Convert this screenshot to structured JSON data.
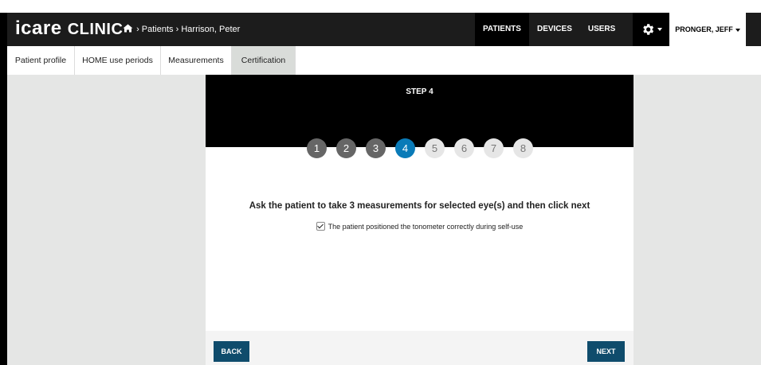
{
  "brand": {
    "logo": "icare",
    "logo_suffix": "CLINIC"
  },
  "breadcrumb": {
    "items": [
      "Patients",
      "Harrison, Peter"
    ],
    "separator": "›"
  },
  "nav": {
    "links": [
      {
        "label": "PATIENTS",
        "active": true
      },
      {
        "label": "DEVICES",
        "active": false
      },
      {
        "label": "USERS",
        "active": false
      }
    ],
    "settings_icon": "gear-icon",
    "user_label": "PRONGER, JEFF"
  },
  "tabs": [
    {
      "label": "Patient profile",
      "active": false
    },
    {
      "label": "HOME use periods",
      "active": false
    },
    {
      "label": "Measurements",
      "active": false
    },
    {
      "label": "Certification",
      "active": true
    }
  ],
  "wizard": {
    "step_title": "STEP 4",
    "steps": [
      "1",
      "2",
      "3",
      "4",
      "5",
      "6",
      "7",
      "8"
    ],
    "current_step": 4,
    "instruction": "Ask the patient to take 3 measurements for selected eye(s) and then click next",
    "checkbox_label": "The patient positioned the tonometer correctly during self-use",
    "checkbox_checked": true,
    "back_label": "BACK",
    "next_label": "NEXT"
  },
  "colors": {
    "accent": "#0a7bb8",
    "button": "#0f4c6c",
    "navbar": "#1c1c1c"
  }
}
